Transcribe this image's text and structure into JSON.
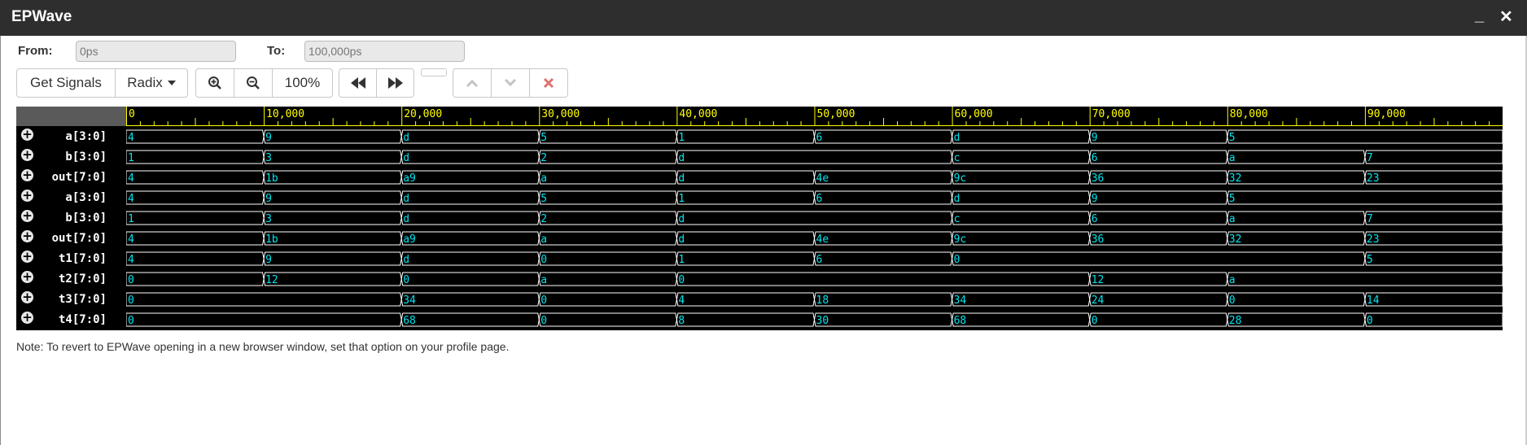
{
  "window": {
    "title": "EPWave",
    "minimize_glyph": "_",
    "close_glyph": "✕"
  },
  "range": {
    "from_label": "From:",
    "from_value": "0ps",
    "to_label": "To:",
    "to_value": "100,000ps"
  },
  "toolbar": {
    "get_signals": "Get Signals",
    "radix": "Radix",
    "zoom_in_icon": "zoom-in-icon",
    "zoom_out_icon": "zoom-out-icon",
    "zoom_level": "100%",
    "prev_icon": "fast-backward-icon",
    "next_icon": "fast-forward-icon",
    "up_icon": "chevron-up-icon",
    "down_icon": "chevron-down-icon",
    "remove_icon": "close-icon"
  },
  "colors": {
    "ruler": "#ffff00",
    "wave": "#ffffff",
    "value": "#00e5ee",
    "remove": "#e05050"
  },
  "timeline": {
    "start": 0,
    "end": 100000,
    "labels": [
      "0",
      "10,000",
      "20,000",
      "30,000",
      "40,000",
      "50,000",
      "60,000",
      "70,000",
      "80,000",
      "90,000"
    ]
  },
  "signals": [
    {
      "name": "a[3:0]",
      "values": [
        [
          0,
          "4"
        ],
        [
          10000,
          "9"
        ],
        [
          20000,
          "d"
        ],
        [
          30000,
          "5"
        ],
        [
          40000,
          "1"
        ],
        [
          50000,
          "6"
        ],
        [
          60000,
          "d"
        ],
        [
          70000,
          "9"
        ],
        [
          80000,
          "5"
        ]
      ]
    },
    {
      "name": "b[3:0]",
      "values": [
        [
          0,
          "1"
        ],
        [
          10000,
          "3"
        ],
        [
          20000,
          "d"
        ],
        [
          30000,
          "2"
        ],
        [
          40000,
          "d"
        ],
        [
          60000,
          "c"
        ],
        [
          70000,
          "6"
        ],
        [
          80000,
          "a"
        ],
        [
          90000,
          "7"
        ]
      ]
    },
    {
      "name": "out[7:0]",
      "values": [
        [
          0,
          "4"
        ],
        [
          10000,
          "1b"
        ],
        [
          20000,
          "a9"
        ],
        [
          30000,
          "a"
        ],
        [
          40000,
          "d"
        ],
        [
          50000,
          "4e"
        ],
        [
          60000,
          "9c"
        ],
        [
          70000,
          "36"
        ],
        [
          80000,
          "32"
        ],
        [
          90000,
          "23"
        ]
      ]
    },
    {
      "name": "a[3:0]",
      "values": [
        [
          0,
          "4"
        ],
        [
          10000,
          "9"
        ],
        [
          20000,
          "d"
        ],
        [
          30000,
          "5"
        ],
        [
          40000,
          "1"
        ],
        [
          50000,
          "6"
        ],
        [
          60000,
          "d"
        ],
        [
          70000,
          "9"
        ],
        [
          80000,
          "5"
        ]
      ]
    },
    {
      "name": "b[3:0]",
      "values": [
        [
          0,
          "1"
        ],
        [
          10000,
          "3"
        ],
        [
          20000,
          "d"
        ],
        [
          30000,
          "2"
        ],
        [
          40000,
          "d"
        ],
        [
          60000,
          "c"
        ],
        [
          70000,
          "6"
        ],
        [
          80000,
          "a"
        ],
        [
          90000,
          "7"
        ]
      ]
    },
    {
      "name": "out[7:0]",
      "values": [
        [
          0,
          "4"
        ],
        [
          10000,
          "1b"
        ],
        [
          20000,
          "a9"
        ],
        [
          30000,
          "a"
        ],
        [
          40000,
          "d"
        ],
        [
          50000,
          "4e"
        ],
        [
          60000,
          "9c"
        ],
        [
          70000,
          "36"
        ],
        [
          80000,
          "32"
        ],
        [
          90000,
          "23"
        ]
      ]
    },
    {
      "name": "t1[7:0]",
      "values": [
        [
          0,
          "4"
        ],
        [
          10000,
          "9"
        ],
        [
          20000,
          "d"
        ],
        [
          30000,
          "0"
        ],
        [
          40000,
          "1"
        ],
        [
          50000,
          "6"
        ],
        [
          60000,
          "0"
        ],
        [
          90000,
          "5"
        ]
      ]
    },
    {
      "name": "t2[7:0]",
      "values": [
        [
          0,
          "0"
        ],
        [
          10000,
          "12"
        ],
        [
          20000,
          "0"
        ],
        [
          30000,
          "a"
        ],
        [
          40000,
          "0"
        ],
        [
          70000,
          "12"
        ],
        [
          80000,
          "a"
        ]
      ]
    },
    {
      "name": "t3[7:0]",
      "values": [
        [
          0,
          "0"
        ],
        [
          20000,
          "34"
        ],
        [
          30000,
          "0"
        ],
        [
          40000,
          "4"
        ],
        [
          50000,
          "18"
        ],
        [
          60000,
          "34"
        ],
        [
          70000,
          "24"
        ],
        [
          80000,
          "0"
        ],
        [
          90000,
          "14"
        ]
      ]
    },
    {
      "name": "t4[7:0]",
      "values": [
        [
          0,
          "0"
        ],
        [
          20000,
          "68"
        ],
        [
          30000,
          "0"
        ],
        [
          40000,
          "8"
        ],
        [
          50000,
          "30"
        ],
        [
          60000,
          "68"
        ],
        [
          70000,
          "0"
        ],
        [
          80000,
          "28"
        ],
        [
          90000,
          "0"
        ]
      ]
    }
  ],
  "note": "Note: To revert to EPWave opening in a new browser window, set that option on your profile page."
}
